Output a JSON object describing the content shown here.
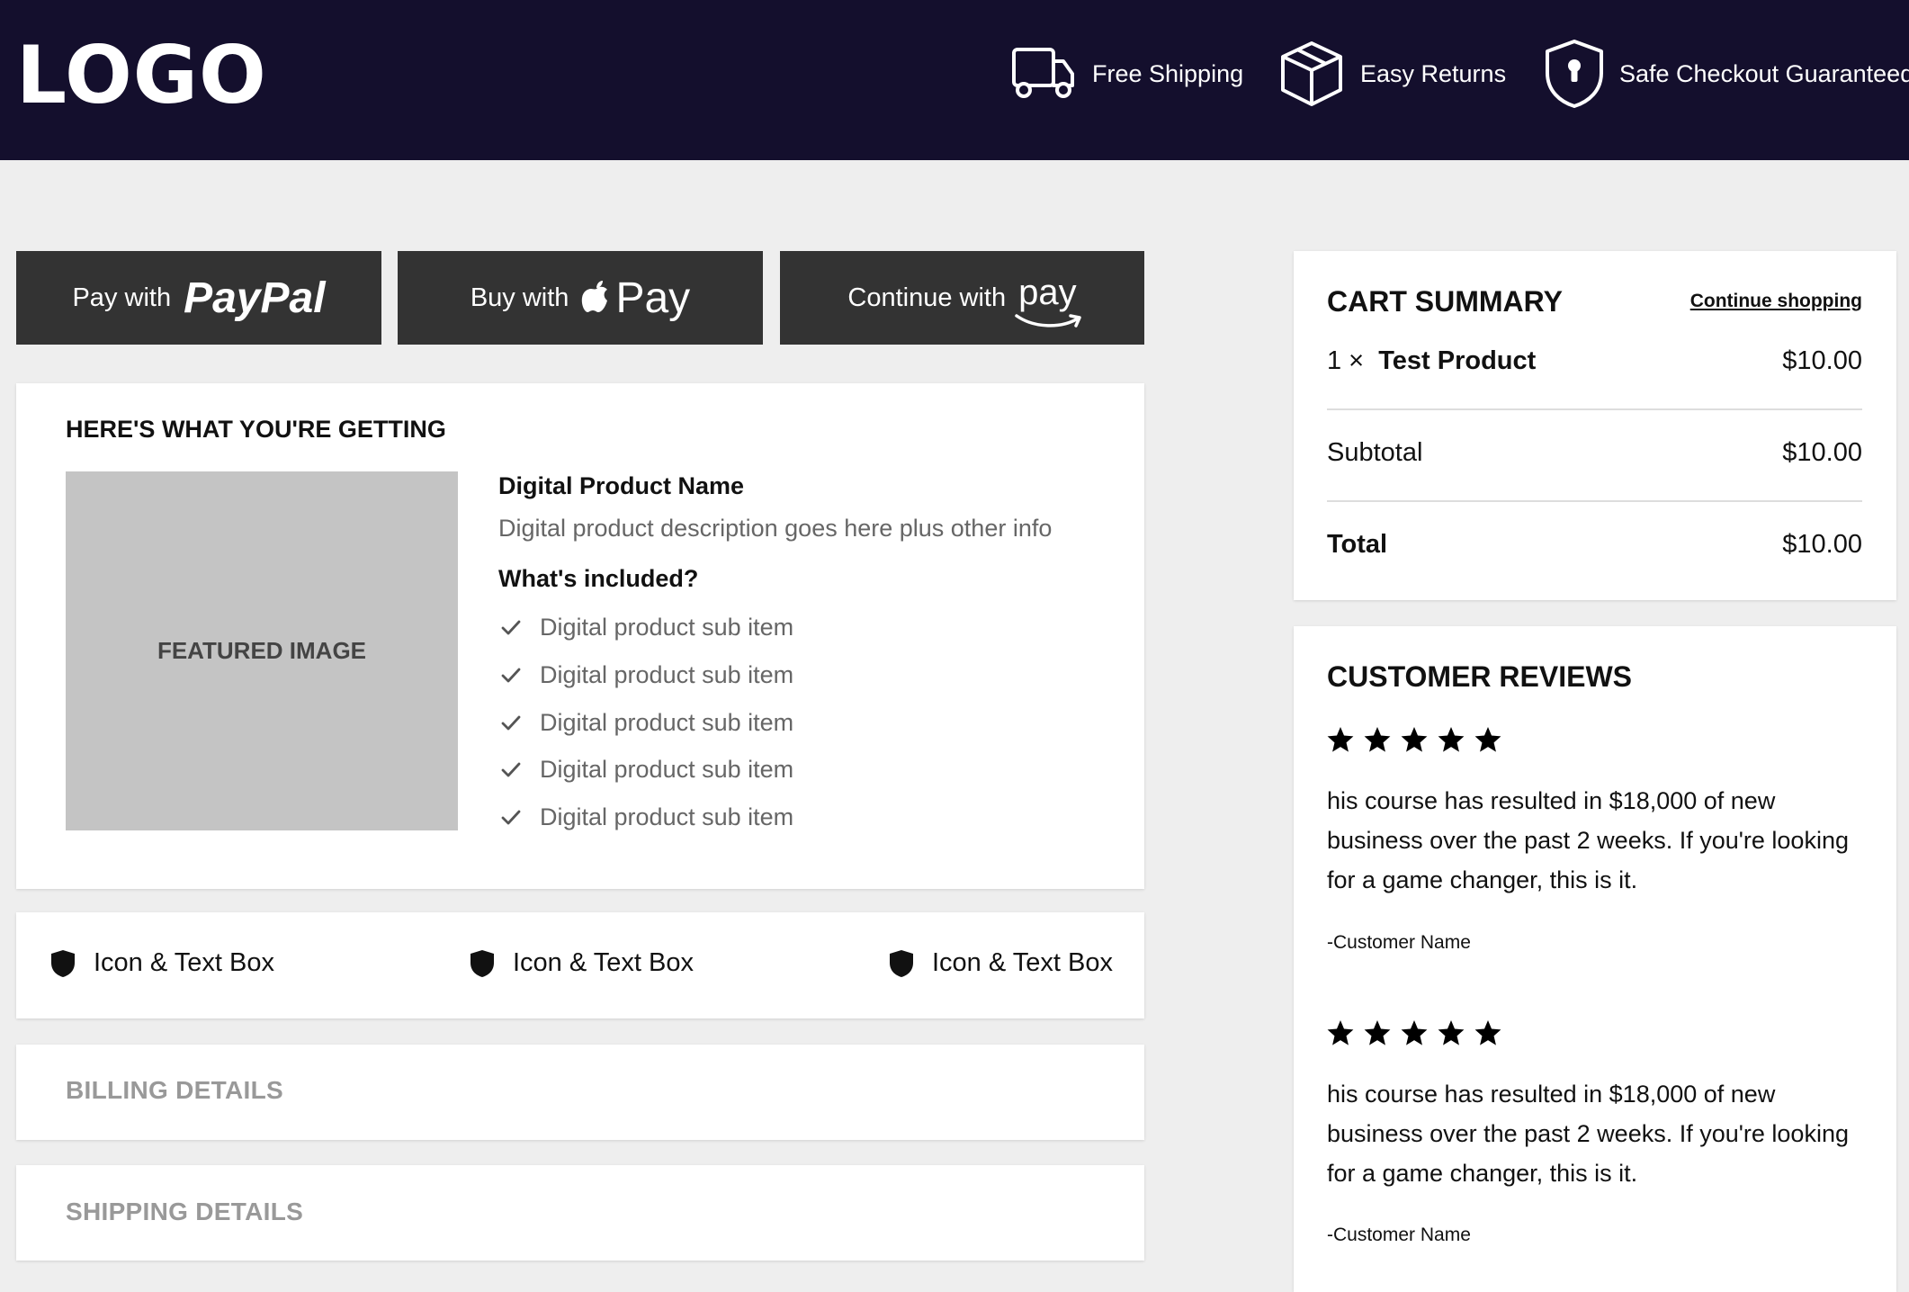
{
  "header": {
    "logo": "LOGO",
    "badges": [
      {
        "icon": "truck-icon",
        "label": "Free Shipping"
      },
      {
        "icon": "box-icon",
        "label": "Easy Returns"
      },
      {
        "icon": "shield-lock-icon",
        "label": "Safe Checkout Guaranteed"
      }
    ]
  },
  "payment": {
    "paypal": {
      "prefix": "Pay with",
      "brand": "PayPal"
    },
    "applepay": {
      "prefix": "Buy with",
      "brand": "Pay",
      "icon": "apple-icon"
    },
    "amazonpay": {
      "prefix": "Continue with",
      "brand": "pay",
      "icon": "amazon-smile-icon"
    }
  },
  "getting": {
    "title": "HERE'S WHAT YOU'RE GETTING",
    "image_label": "FEATURED IMAGE",
    "product_name": "Digital Product Name",
    "description": "Digital product description goes here plus other info",
    "included_title": "What's included?",
    "items": [
      "Digital product sub item",
      "Digital product sub item",
      "Digital product sub item",
      "Digital product sub item",
      "Digital product sub item"
    ]
  },
  "icon_boxes": [
    {
      "icon": "shield-icon",
      "label": "Icon & Text Box"
    },
    {
      "icon": "shield-icon",
      "label": "Icon & Text Box"
    },
    {
      "icon": "shield-icon",
      "label": "Icon & Text Box"
    }
  ],
  "sections": {
    "billing": "BILLING DETAILS",
    "shipping": "SHIPPING DETAILS"
  },
  "cart": {
    "title": "CART SUMMARY",
    "continue_link": "Continue shopping",
    "item": {
      "qty": "1 ×",
      "name": "Test Product",
      "price": "$10.00"
    },
    "subtotal_label": "Subtotal",
    "subtotal_value": "$10.00",
    "total_label": "Total",
    "total_value": "$10.00"
  },
  "reviews": {
    "title": "CUSTOMER REVIEWS",
    "items": [
      {
        "rating": 5,
        "text": "his course has resulted in $18,000 of new business over the past 2 weeks. If you're looking for a game changer, this is it.",
        "author": "-Customer Name"
      },
      {
        "rating": 5,
        "text": "his course has resulted in $18,000 of new business over the past 2 weeks. If you're looking for a game changer, this is it.",
        "author": "-Customer Name"
      }
    ]
  }
}
